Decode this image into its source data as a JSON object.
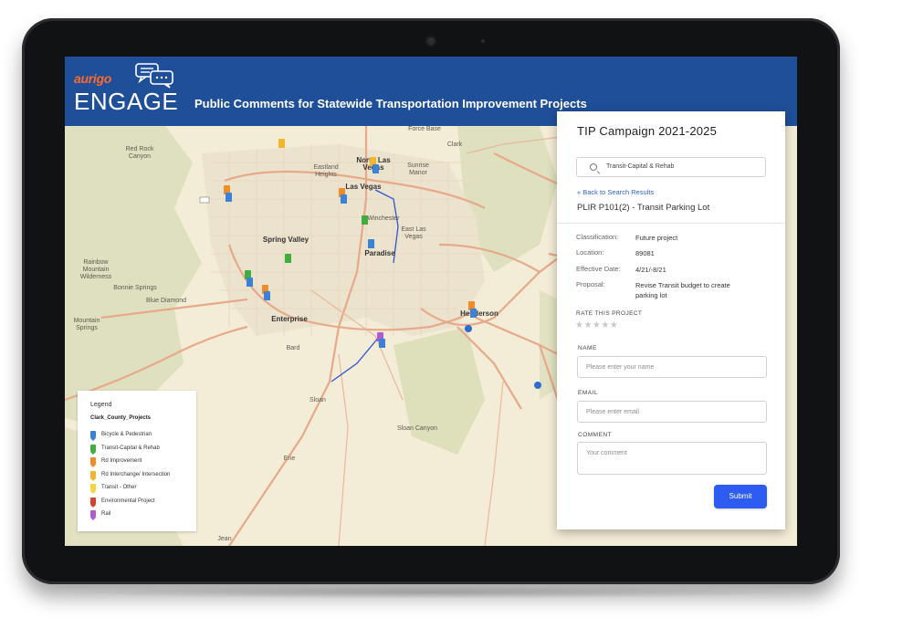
{
  "header": {
    "brand": "aurigo",
    "product": "ENGAGE",
    "title": "Public Comments for Statewide Transportation Improvement Projects"
  },
  "map": {
    "labels": {
      "red_rock_canyon": "Red Rock Canyon",
      "eastland_heights": "Eastland Heights",
      "north_las_vegas": "North Las Vegas",
      "sunrise_manor": "Sunrise Manor",
      "clark": "Clark",
      "las_vegas": "Las Vegas",
      "winchester": "Winchester",
      "east_las_vegas": "East Las Vegas",
      "spring_valley": "Spring Valley",
      "paradise": "Paradise",
      "rainbow_mountain": "Rainbow Mountain Wilderness",
      "bonnie_springs": "Bonnie Springs",
      "blue_diamond": "Blue Diamond",
      "mountain_springs": "Mountain Springs",
      "enterprise": "Enterprise",
      "henderson": "Henderson",
      "bard": "Bard",
      "sloan": "Sloan",
      "sloan_canyon": "Sloan Canyon",
      "erie": "Erie",
      "jean": "Jean",
      "force_base": "Force Base"
    }
  },
  "legend": {
    "title": "Legend",
    "layer": "Clark_County_Projects",
    "items": [
      {
        "label": "Bicycle & Pedestrian",
        "color": "#3b82d6"
      },
      {
        "label": "Transit-Capital & Rehab",
        "color": "#3fae3f"
      },
      {
        "label": "Rd Improvement",
        "color": "#f08c2a"
      },
      {
        "label": "Rd Interchange/ Intersection",
        "color": "#f2b62a"
      },
      {
        "label": "Transit - Other",
        "color": "#f7d53d"
      },
      {
        "label": "Environmental Project",
        "color": "#d6422f"
      },
      {
        "label": "Rail",
        "color": "#b05bd0"
      }
    ]
  },
  "panel": {
    "title": "TIP Campaign 2021-2025",
    "search_value": "Transit-Capital & Rehab",
    "back_link": "« Back to Search Results",
    "project_name": "PLIR P101(2) - Transit Parking Lot",
    "fields": {
      "classification_label": "Classification:",
      "classification_value": "Future project",
      "location_label": "Location:",
      "location_value": "89081",
      "effective_label": "Effective Date:",
      "effective_value": "4/21/-8/21",
      "proposal_label": "Proposal:",
      "proposal_value": "Revise Transit budget to create parking lot"
    },
    "rate_label": "RATE THIS PROJECT",
    "stars": "★★★★★",
    "form": {
      "name_label": "NAME",
      "name_placeholder": "Please enter your name",
      "email_label": "EMAIL",
      "email_placeholder": "Please enter email",
      "comment_label": "COMMENT",
      "comment_placeholder": "Your comment",
      "submit_label": "Submit"
    }
  },
  "colors": {
    "header_bg": "#1f4f99",
    "brand": "#ff6a2a",
    "accent": "#2e5cf0",
    "link": "#2f5fd0"
  }
}
